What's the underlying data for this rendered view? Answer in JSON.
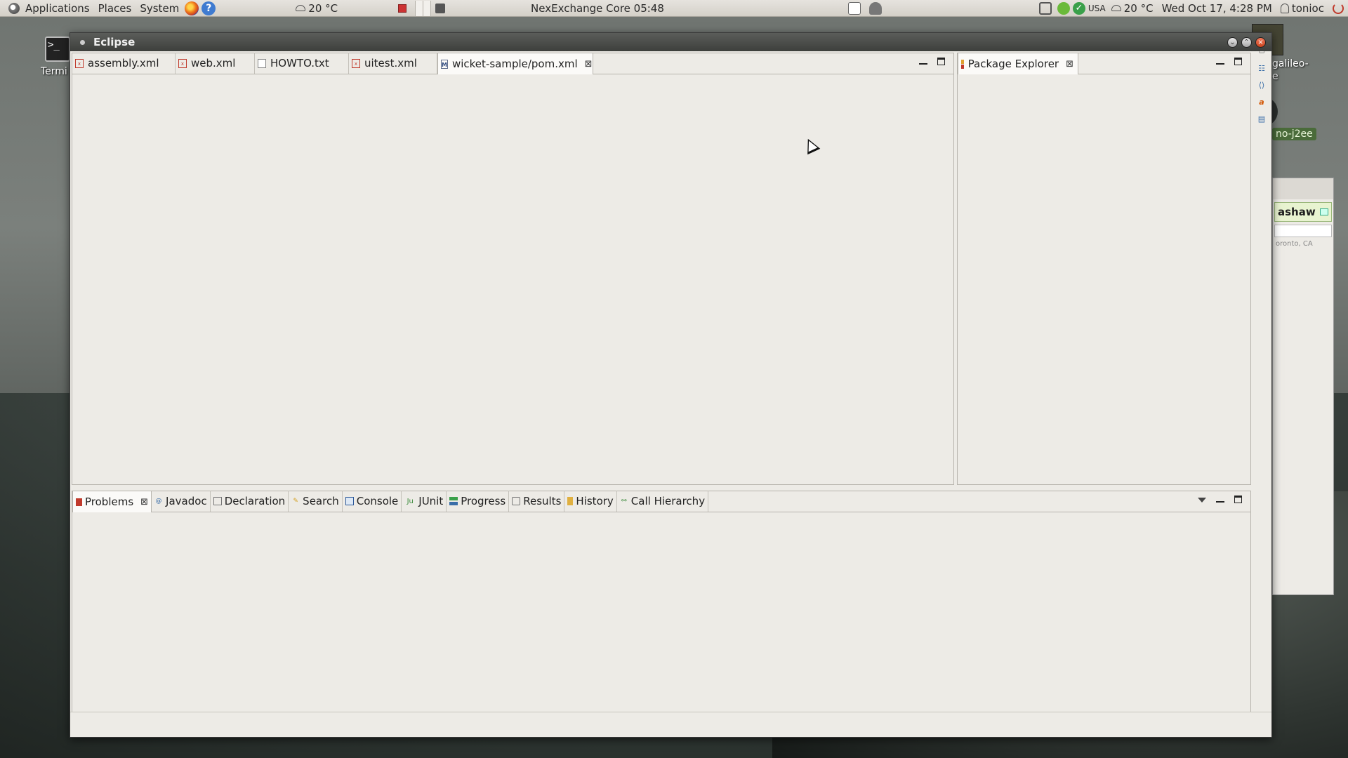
{
  "top_panel": {
    "menus": [
      "Applications",
      "Places",
      "System"
    ],
    "weather_left": "20 °C",
    "center_clock": "NexExchange Core 05:48",
    "keyboard_layout": "USA",
    "weather_right": "20 °C",
    "datetime": "Wed Oct 17,  4:28 PM",
    "user": "tonioc"
  },
  "desktop": {
    "terminal_label": "Termi",
    "galileo_label": "galileo-",
    "galileo_label2": "e",
    "j2ee_label": "no-j2ee"
  },
  "side_window": {
    "contact_name": "ashaw",
    "location": "oronto, CA"
  },
  "window": {
    "title": "Eclipse"
  },
  "editor_tabs": [
    {
      "label": "assembly.xml",
      "icon": "xml-file-icon"
    },
    {
      "label": "web.xml",
      "icon": "xml-file-icon"
    },
    {
      "label": "HOWTO.txt",
      "icon": "text-file-icon"
    },
    {
      "label": "uitest.xml",
      "icon": "xml-file-icon"
    },
    {
      "label": "wicket-sample/pom.xml",
      "icon": "maven-pom-icon",
      "active": true
    }
  ],
  "package_explorer": {
    "tab_label": "Package Explorer"
  },
  "bottom_tabs": [
    {
      "label": "Problems",
      "icon": "problems-icon",
      "active": true
    },
    {
      "label": "Javadoc",
      "icon": "javadoc-icon"
    },
    {
      "label": "Declaration",
      "icon": "declaration-icon"
    },
    {
      "label": "Search",
      "icon": "search-icon"
    },
    {
      "label": "Console",
      "icon": "console-icon"
    },
    {
      "label": "JUnit",
      "icon": "junit-icon"
    },
    {
      "label": "Progress",
      "icon": "progress-icon"
    },
    {
      "label": "Results",
      "icon": "results-icon"
    },
    {
      "label": "History",
      "icon": "history-icon"
    },
    {
      "label": "Call Hierarchy",
      "icon": "call-hierarchy-icon"
    }
  ],
  "junit_icon_text": "Ju"
}
